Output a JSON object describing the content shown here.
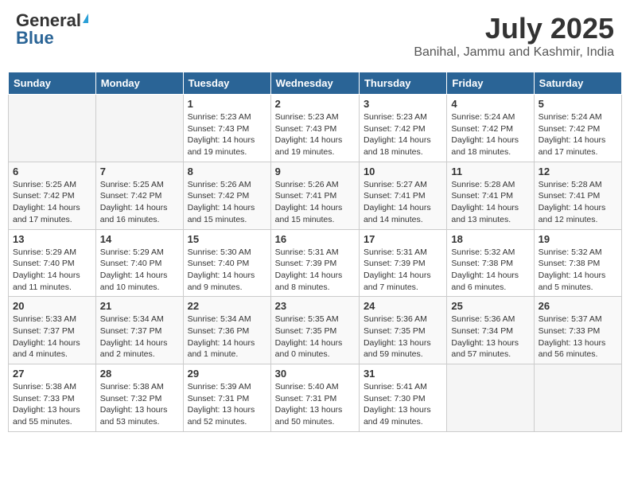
{
  "header": {
    "logo_general": "General",
    "logo_blue": "Blue",
    "month_title": "July 2025",
    "location": "Banihal, Jammu and Kashmir, India"
  },
  "days_of_week": [
    "Sunday",
    "Monday",
    "Tuesday",
    "Wednesday",
    "Thursday",
    "Friday",
    "Saturday"
  ],
  "weeks": [
    [
      {
        "day": "",
        "sunrise": "",
        "sunset": "",
        "daylight": ""
      },
      {
        "day": "",
        "sunrise": "",
        "sunset": "",
        "daylight": ""
      },
      {
        "day": "1",
        "sunrise": "Sunrise: 5:23 AM",
        "sunset": "Sunset: 7:43 PM",
        "daylight": "Daylight: 14 hours and 19 minutes."
      },
      {
        "day": "2",
        "sunrise": "Sunrise: 5:23 AM",
        "sunset": "Sunset: 7:43 PM",
        "daylight": "Daylight: 14 hours and 19 minutes."
      },
      {
        "day": "3",
        "sunrise": "Sunrise: 5:23 AM",
        "sunset": "Sunset: 7:42 PM",
        "daylight": "Daylight: 14 hours and 18 minutes."
      },
      {
        "day": "4",
        "sunrise": "Sunrise: 5:24 AM",
        "sunset": "Sunset: 7:42 PM",
        "daylight": "Daylight: 14 hours and 18 minutes."
      },
      {
        "day": "5",
        "sunrise": "Sunrise: 5:24 AM",
        "sunset": "Sunset: 7:42 PM",
        "daylight": "Daylight: 14 hours and 17 minutes."
      }
    ],
    [
      {
        "day": "6",
        "sunrise": "Sunrise: 5:25 AM",
        "sunset": "Sunset: 7:42 PM",
        "daylight": "Daylight: 14 hours and 17 minutes."
      },
      {
        "day": "7",
        "sunrise": "Sunrise: 5:25 AM",
        "sunset": "Sunset: 7:42 PM",
        "daylight": "Daylight: 14 hours and 16 minutes."
      },
      {
        "day": "8",
        "sunrise": "Sunrise: 5:26 AM",
        "sunset": "Sunset: 7:42 PM",
        "daylight": "Daylight: 14 hours and 15 minutes."
      },
      {
        "day": "9",
        "sunrise": "Sunrise: 5:26 AM",
        "sunset": "Sunset: 7:41 PM",
        "daylight": "Daylight: 14 hours and 15 minutes."
      },
      {
        "day": "10",
        "sunrise": "Sunrise: 5:27 AM",
        "sunset": "Sunset: 7:41 PM",
        "daylight": "Daylight: 14 hours and 14 minutes."
      },
      {
        "day": "11",
        "sunrise": "Sunrise: 5:28 AM",
        "sunset": "Sunset: 7:41 PM",
        "daylight": "Daylight: 14 hours and 13 minutes."
      },
      {
        "day": "12",
        "sunrise": "Sunrise: 5:28 AM",
        "sunset": "Sunset: 7:41 PM",
        "daylight": "Daylight: 14 hours and 12 minutes."
      }
    ],
    [
      {
        "day": "13",
        "sunrise": "Sunrise: 5:29 AM",
        "sunset": "Sunset: 7:40 PM",
        "daylight": "Daylight: 14 hours and 11 minutes."
      },
      {
        "day": "14",
        "sunrise": "Sunrise: 5:29 AM",
        "sunset": "Sunset: 7:40 PM",
        "daylight": "Daylight: 14 hours and 10 minutes."
      },
      {
        "day": "15",
        "sunrise": "Sunrise: 5:30 AM",
        "sunset": "Sunset: 7:40 PM",
        "daylight": "Daylight: 14 hours and 9 minutes."
      },
      {
        "day": "16",
        "sunrise": "Sunrise: 5:31 AM",
        "sunset": "Sunset: 7:39 PM",
        "daylight": "Daylight: 14 hours and 8 minutes."
      },
      {
        "day": "17",
        "sunrise": "Sunrise: 5:31 AM",
        "sunset": "Sunset: 7:39 PM",
        "daylight": "Daylight: 14 hours and 7 minutes."
      },
      {
        "day": "18",
        "sunrise": "Sunrise: 5:32 AM",
        "sunset": "Sunset: 7:38 PM",
        "daylight": "Daylight: 14 hours and 6 minutes."
      },
      {
        "day": "19",
        "sunrise": "Sunrise: 5:32 AM",
        "sunset": "Sunset: 7:38 PM",
        "daylight": "Daylight: 14 hours and 5 minutes."
      }
    ],
    [
      {
        "day": "20",
        "sunrise": "Sunrise: 5:33 AM",
        "sunset": "Sunset: 7:37 PM",
        "daylight": "Daylight: 14 hours and 4 minutes."
      },
      {
        "day": "21",
        "sunrise": "Sunrise: 5:34 AM",
        "sunset": "Sunset: 7:37 PM",
        "daylight": "Daylight: 14 hours and 2 minutes."
      },
      {
        "day": "22",
        "sunrise": "Sunrise: 5:34 AM",
        "sunset": "Sunset: 7:36 PM",
        "daylight": "Daylight: 14 hours and 1 minute."
      },
      {
        "day": "23",
        "sunrise": "Sunrise: 5:35 AM",
        "sunset": "Sunset: 7:35 PM",
        "daylight": "Daylight: 14 hours and 0 minutes."
      },
      {
        "day": "24",
        "sunrise": "Sunrise: 5:36 AM",
        "sunset": "Sunset: 7:35 PM",
        "daylight": "Daylight: 13 hours and 59 minutes."
      },
      {
        "day": "25",
        "sunrise": "Sunrise: 5:36 AM",
        "sunset": "Sunset: 7:34 PM",
        "daylight": "Daylight: 13 hours and 57 minutes."
      },
      {
        "day": "26",
        "sunrise": "Sunrise: 5:37 AM",
        "sunset": "Sunset: 7:33 PM",
        "daylight": "Daylight: 13 hours and 56 minutes."
      }
    ],
    [
      {
        "day": "27",
        "sunrise": "Sunrise: 5:38 AM",
        "sunset": "Sunset: 7:33 PM",
        "daylight": "Daylight: 13 hours and 55 minutes."
      },
      {
        "day": "28",
        "sunrise": "Sunrise: 5:38 AM",
        "sunset": "Sunset: 7:32 PM",
        "daylight": "Daylight: 13 hours and 53 minutes."
      },
      {
        "day": "29",
        "sunrise": "Sunrise: 5:39 AM",
        "sunset": "Sunset: 7:31 PM",
        "daylight": "Daylight: 13 hours and 52 minutes."
      },
      {
        "day": "30",
        "sunrise": "Sunrise: 5:40 AM",
        "sunset": "Sunset: 7:31 PM",
        "daylight": "Daylight: 13 hours and 50 minutes."
      },
      {
        "day": "31",
        "sunrise": "Sunrise: 5:41 AM",
        "sunset": "Sunset: 7:30 PM",
        "daylight": "Daylight: 13 hours and 49 minutes."
      },
      {
        "day": "",
        "sunrise": "",
        "sunset": "",
        "daylight": ""
      },
      {
        "day": "",
        "sunrise": "",
        "sunset": "",
        "daylight": ""
      }
    ]
  ]
}
